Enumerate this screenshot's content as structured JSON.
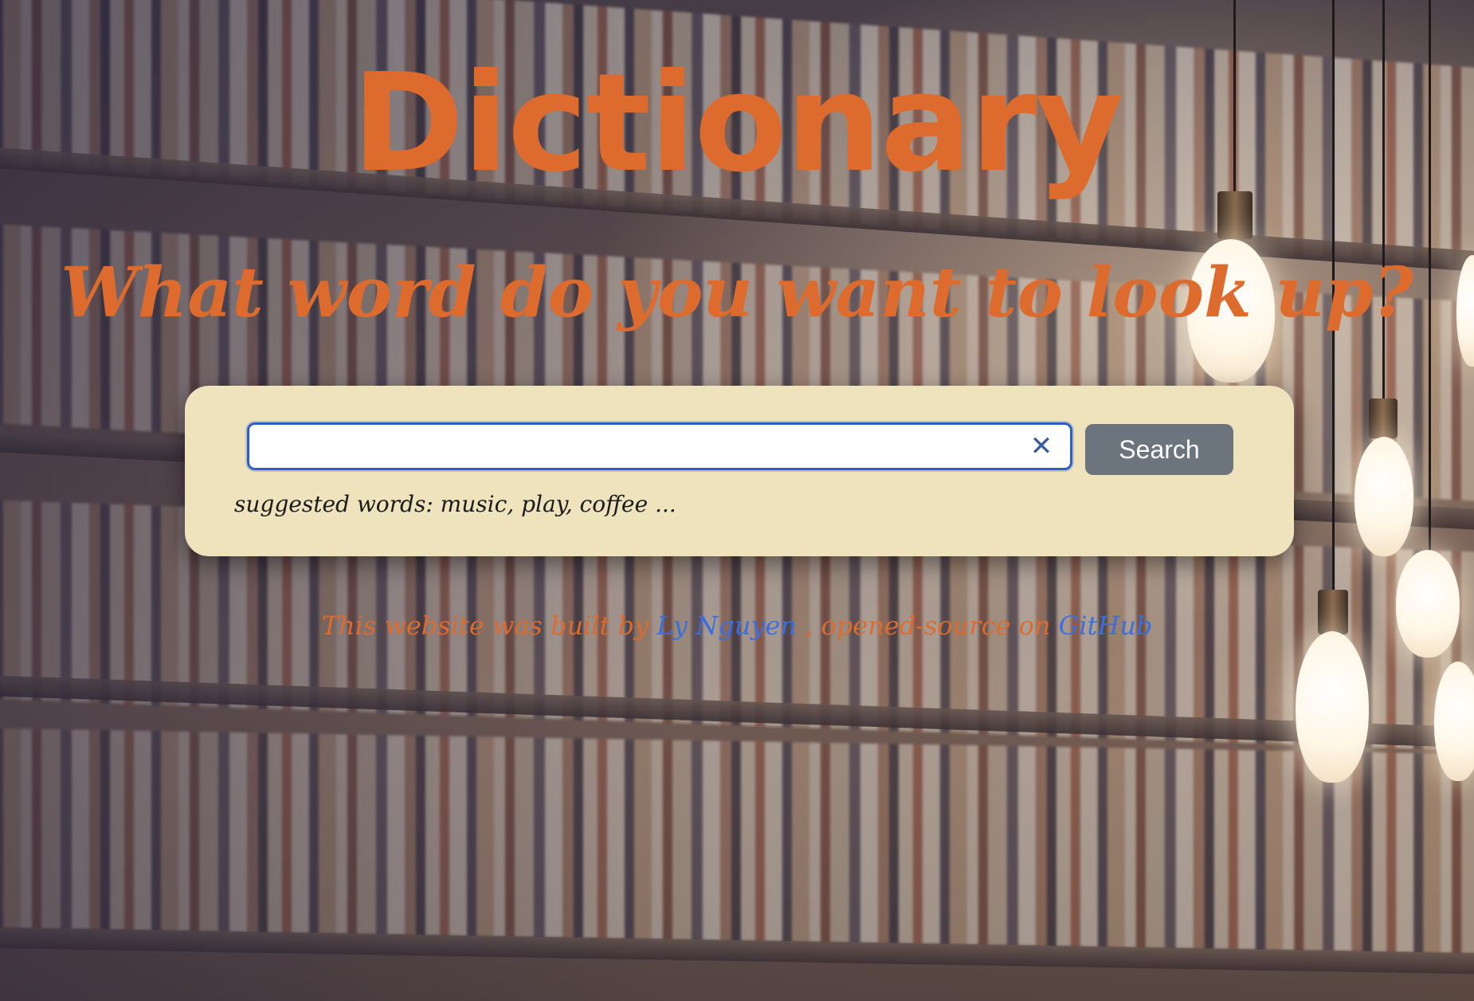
{
  "header": {
    "title": "Dictionary",
    "subtitle": "What word do you want to look up?"
  },
  "search": {
    "value": "",
    "clear_symbol": "✕",
    "button_label": "Search",
    "suggested_text": "suggested words: music, play, coffee ..."
  },
  "footer": {
    "prefix": "This website was built by ",
    "author_link": "Ly Nguyen",
    "middle": " , opened-source on ",
    "repo_link": "GitHub"
  },
  "colors": {
    "accent": "#dd6b2e",
    "card_background": "#eee3bc",
    "button_background": "#6c757d",
    "link": "#3a6fe0",
    "input_focus_border": "#2f5fc4"
  }
}
